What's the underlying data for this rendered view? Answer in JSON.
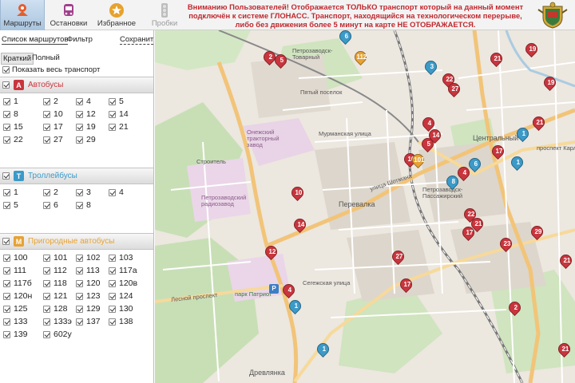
{
  "nav": {
    "tabs": [
      {
        "label": "Маршруты",
        "icon": "route-pin-icon"
      },
      {
        "label": "Остановки",
        "icon": "bus-stop-icon"
      },
      {
        "label": "Избранное",
        "icon": "star-icon"
      },
      {
        "label": "Пробки",
        "icon": "traffic-light-icon"
      }
    ],
    "notice": "Вниманию Пользователей! Отображается ТОЛЬКО транспорт который на данный момент подключён к системе ГЛОНАСС. Транспорт, находящийся на технологическом перерыве, либо без движения более 5 минут на карте НЕ ОТОБРАЖАЕТСЯ."
  },
  "sidebar": {
    "tab_list": "Список маршрутов",
    "tab_filter": "Фильтр",
    "save": "Сохранить",
    "mode_short": "Краткий",
    "mode_full": "Полный",
    "show_all": "Показать весь транспорт",
    "sections": [
      {
        "title": "Автобусы",
        "badge": "А",
        "color": "#c9353d",
        "routes": [
          "1",
          "2",
          "4",
          "5",
          "8",
          "10",
          "12",
          "14",
          "15",
          "17",
          "19",
          "21",
          "22",
          "27",
          "29"
        ]
      },
      {
        "title": "Троллейбусы",
        "badge": "Т",
        "color": "#3b9ac8",
        "routes": [
          "1",
          "2",
          "3",
          "4",
          "5",
          "6",
          "8"
        ]
      },
      {
        "title": "Пригородные автобусы",
        "badge": "М",
        "color": "#e7a233",
        "routes": [
          "100",
          "101",
          "102",
          "103",
          "111",
          "112",
          "113",
          "117а",
          "117б",
          "118",
          "120",
          "120в",
          "120н",
          "121",
          "123",
          "124",
          "125",
          "128",
          "129",
          "130",
          "133",
          "133э",
          "137",
          "138",
          "139",
          "602у"
        ]
      }
    ]
  },
  "map": {
    "labels": {
      "district1": "Пятый поселок",
      "district2": "Перевалка",
      "district3": "Древлянка",
      "district4": "Центральный",
      "station1": "Петрозаводск-Товарный",
      "station2": "Петрозаводск-Пассажирский",
      "zavod": "Онежский тракторный завод",
      "radiozavod": "Петрозаводский радиозавод",
      "stroitel": "Строитель",
      "park": "парк Патриот",
      "street1": "Мурманская улица",
      "street2": "улица Шотмана",
      "street3": "Сегежская улица",
      "street4": "проспект Карла Маркса",
      "street5": "Лесной проспект"
    },
    "markers": [
      {
        "n": "2",
        "t": "bus"
      },
      {
        "n": "5",
        "t": "bus"
      },
      {
        "n": "112",
        "t": "sub"
      },
      {
        "n": "6",
        "t": "trol"
      },
      {
        "n": "3",
        "t": "trol"
      },
      {
        "n": "22",
        "t": "bus"
      },
      {
        "n": "27",
        "t": "bus"
      },
      {
        "n": "21",
        "t": "bus"
      },
      {
        "n": "19",
        "t": "bus"
      },
      {
        "n": "19",
        "t": "bus"
      },
      {
        "n": "4",
        "t": "bus"
      },
      {
        "n": "14",
        "t": "bus"
      },
      {
        "n": "5",
        "t": "bus"
      },
      {
        "n": "10",
        "t": "bus"
      },
      {
        "n": "101",
        "t": "sub"
      },
      {
        "n": "4",
        "t": "bus"
      },
      {
        "n": "6",
        "t": "trol"
      },
      {
        "n": "8",
        "t": "trol"
      },
      {
        "n": "17",
        "t": "bus"
      },
      {
        "n": "1",
        "t": "trol"
      },
      {
        "n": "21",
        "t": "bus"
      },
      {
        "n": "1",
        "t": "trol"
      },
      {
        "n": "10",
        "t": "bus"
      },
      {
        "n": "14",
        "t": "bus"
      },
      {
        "n": "22",
        "t": "bus"
      },
      {
        "n": "21",
        "t": "bus"
      },
      {
        "n": "17",
        "t": "bus"
      },
      {
        "n": "12",
        "t": "bus"
      },
      {
        "n": "27",
        "t": "bus"
      },
      {
        "n": "29",
        "t": "bus"
      },
      {
        "n": "17",
        "t": "bus"
      },
      {
        "n": "4",
        "t": "bus"
      },
      {
        "n": "1",
        "t": "trol"
      },
      {
        "n": "2",
        "t": "bus"
      },
      {
        "n": "1",
        "t": "trol"
      },
      {
        "n": "21",
        "t": "bus"
      },
      {
        "n": "21",
        "t": "bus"
      },
      {
        "n": "23",
        "t": "bus"
      }
    ]
  }
}
